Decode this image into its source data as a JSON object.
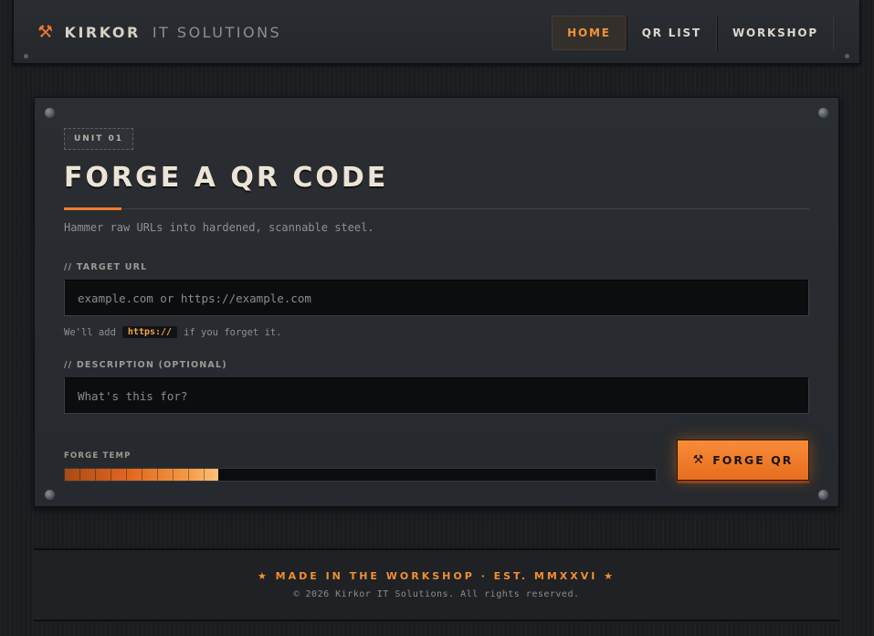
{
  "brand": {
    "icon": "hammer-icon",
    "name": "KIRKOR",
    "subtitle": "IT SOLUTIONS"
  },
  "nav": {
    "items": [
      {
        "label": "HOME",
        "active": true
      },
      {
        "label": "QR LIST",
        "active": false
      },
      {
        "label": "WORKSHOP",
        "active": false
      }
    ]
  },
  "panel": {
    "badge": "UNIT 01",
    "title": "FORGE A QR CODE",
    "subtitle": "Hammer raw URLs into hardened, scannable steel.",
    "url_label": "// TARGET URL",
    "url_placeholder": "example.com or https://example.com",
    "url_value": "",
    "hint_before": "We'll add",
    "hint_code": "https://",
    "hint_after": "if you forget it.",
    "desc_label": "// DESCRIPTION (OPTIONAL)",
    "desc_placeholder": "What's this for?",
    "desc_value": "",
    "temp_label": "FORGE TEMP",
    "temp_level": 0.26,
    "button_label": "FORGE QR",
    "button_icon": "hammer-pick-icon"
  },
  "footer": {
    "tagline": "★ MADE IN THE WORKSHOP · EST. MMXXVI ★",
    "copyright": "© 2026 Kirkor IT Solutions. All rights reserved."
  },
  "colors": {
    "accent": "#ef7b2c",
    "background": "#1b1d20",
    "panel": "#282b2f",
    "text": "#ece4d6"
  }
}
